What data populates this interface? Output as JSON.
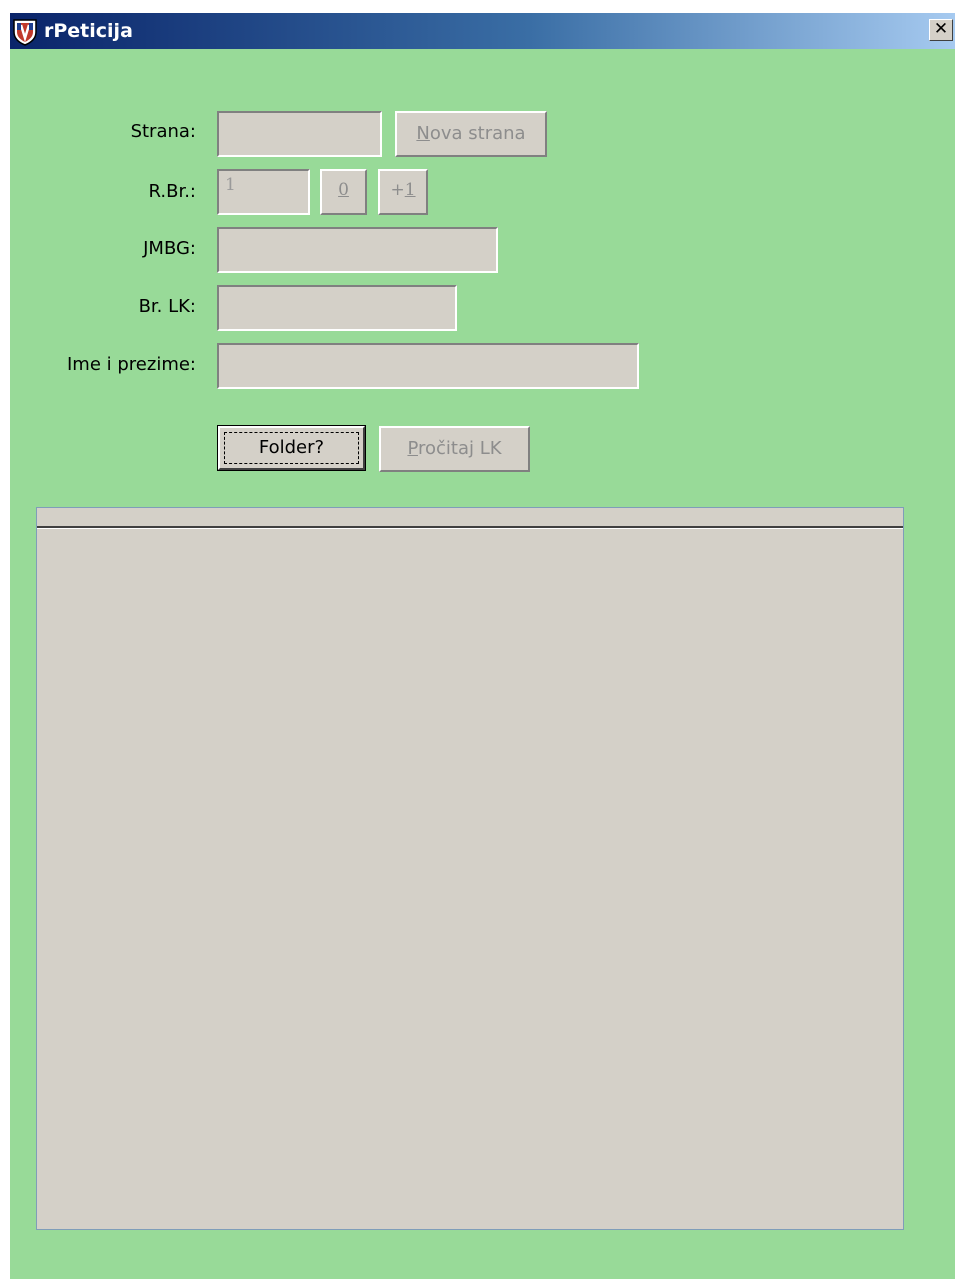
{
  "window": {
    "title": "rPeticija",
    "close_glyph": "✕",
    "icon": "shield-app-icon",
    "background_color": "#98da98"
  },
  "form": {
    "strana": {
      "label": "Strana:",
      "value": ""
    },
    "nova_strana_button": {
      "mnemonic": "N",
      "rest": "ova strana"
    },
    "rbr": {
      "label": "R.Br.:",
      "value": "1"
    },
    "zero_button": {
      "label": "0"
    },
    "plus_one_button": {
      "prefix": "+",
      "mnemonic": "1"
    },
    "jmbg": {
      "label": "JMBG:",
      "value": ""
    },
    "br_lk": {
      "label": "Br. LK:",
      "value": ""
    },
    "ime_prezime": {
      "label": "Ime i prezime:",
      "value": ""
    },
    "folder_button": {
      "label": "Folder?"
    },
    "procitaj_button": {
      "mnemonic": "P",
      "rest": "ročitaj LK"
    }
  },
  "list_panel": {
    "header": ""
  }
}
